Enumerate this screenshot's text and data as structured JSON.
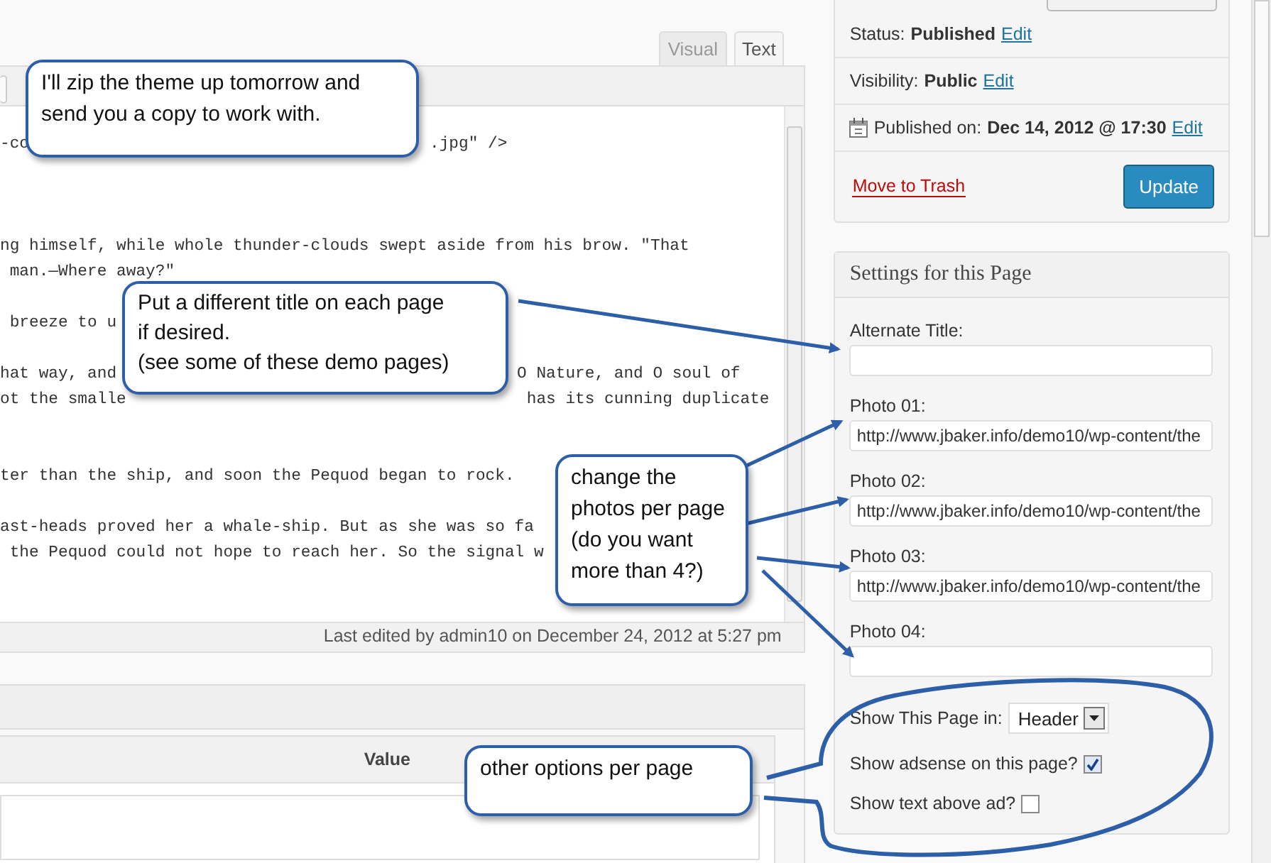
{
  "editor": {
    "tabs": [
      {
        "label": "Visual",
        "selected": false
      },
      {
        "label": "Text",
        "selected": true
      }
    ],
    "lines": [
      {
        "kind": "blank"
      },
      {
        "kind": "text",
        "parts": [
          "-co",
          ".jpg\" />"
        ]
      },
      {
        "kind": "blank"
      },
      {
        "kind": "blank"
      },
      {
        "kind": "blank"
      },
      {
        "kind": "text",
        "parts": [
          "ng himself, while whole thunder-clouds swept aside from his brow. \"That"
        ]
      },
      {
        "kind": "text",
        "parts": [
          " man.—Where away?\""
        ]
      },
      {
        "kind": "blank"
      },
      {
        "kind": "text",
        "parts": [
          " breeze to u"
        ]
      },
      {
        "kind": "blank"
      },
      {
        "kind": "text",
        "parts": [
          "hat way, and",
          "O Nature, and O soul of"
        ]
      },
      {
        "kind": "text",
        "parts": [
          "ot the smalle",
          "has its cunning duplicate"
        ]
      },
      {
        "kind": "blank"
      },
      {
        "kind": "blank"
      },
      {
        "kind": "text",
        "parts": [
          "ter than the ship, and soon the Pequod began to rock."
        ]
      },
      {
        "kind": "blank"
      },
      {
        "kind": "text",
        "parts": [
          "ast-heads proved her a whale-ship. But as she was so fa"
        ]
      },
      {
        "kind": "text",
        "parts": [
          " the Pequod could not hope to reach her. So the signal w"
        ]
      }
    ],
    "footer": "Last edited by admin10 on December 24, 2012 at 5:27 pm"
  },
  "custom_fields": {
    "columns": [
      {
        "label": "Value"
      }
    ]
  },
  "publish": {
    "rows": [
      {
        "kind": "plain",
        "label": "Status:",
        "value": "Published",
        "link": "Edit"
      },
      {
        "kind": "plain",
        "label": "Visibility:",
        "value": "Public",
        "link": "Edit"
      },
      {
        "kind": "date",
        "label": "Published on:",
        "value": "Dec 14, 2012 @ 17:30",
        "link": "Edit"
      }
    ],
    "trash_link": "Move to Trash",
    "update_button": "Update"
  },
  "settings": {
    "title": "Settings for this Page",
    "fields": [
      {
        "kind": "text",
        "label": "Alternate Title:"
      },
      {
        "kind": "text",
        "label": "Photo 01:",
        "value": "http://www.jbaker.info/demo10/wp-content/the"
      },
      {
        "kind": "text",
        "label": "Photo 02:",
        "value": "http://www.jbaker.info/demo10/wp-content/the"
      },
      {
        "kind": "text",
        "label": "Photo 03:",
        "value": "http://www.jbaker.info/demo10/wp-content/the"
      },
      {
        "kind": "text",
        "label": "Photo 04:"
      },
      {
        "kind": "select",
        "label": "Show This Page in:",
        "value": "Header"
      },
      {
        "kind": "checkbox",
        "label": "Show adsense on this page?",
        "checked": true
      },
      {
        "kind": "checkbox",
        "label": "Show text above ad?",
        "checked": false
      }
    ]
  },
  "callouts": [
    {
      "text": "I'll zip the theme up tomorrow and\nsend you a copy to work with."
    },
    {
      "text": "Put a different title on each page\nif desired.\n(see some of these demo pages)"
    },
    {
      "text": "change the\nphotos per page\n(do you want\nmore than 4?)"
    },
    {
      "text": "other options per page"
    }
  ]
}
